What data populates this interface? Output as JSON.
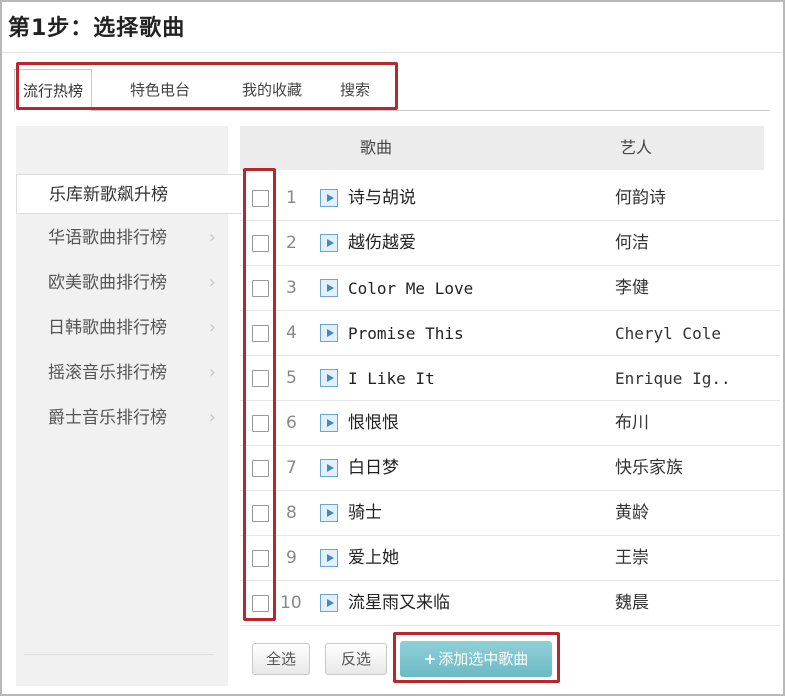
{
  "step_title": "第1步：选择歌曲",
  "tabs": [
    {
      "label": "流行热榜",
      "active": true
    },
    {
      "label": "特色电台",
      "active": false
    },
    {
      "label": "我的收藏",
      "active": false
    },
    {
      "label": "搜索",
      "active": false
    }
  ],
  "sidebar": {
    "items": [
      {
        "label": "乐库新歌飙升榜",
        "active": true,
        "icon": "chevron-right-icon"
      },
      {
        "label": "华语歌曲排行榜",
        "active": false,
        "icon": "chevron-right-icon"
      },
      {
        "label": "欧美歌曲排行榜",
        "active": false,
        "icon": "chevron-right-icon"
      },
      {
        "label": "日韩歌曲排行榜",
        "active": false,
        "icon": "chevron-right-icon"
      },
      {
        "label": "摇滚音乐排行榜",
        "active": false,
        "icon": "chevron-right-icon"
      },
      {
        "label": "爵士音乐排行榜",
        "active": false,
        "icon": "chevron-right-icon"
      }
    ]
  },
  "table": {
    "headers": {
      "song": "歌曲",
      "artist": "艺人"
    },
    "rows": [
      {
        "num": "1",
        "song": "诗与胡说",
        "artist": "何韵诗",
        "checked": false
      },
      {
        "num": "2",
        "song": "越伤越爱",
        "artist": "何洁",
        "checked": false
      },
      {
        "num": "3",
        "song": "Color Me Love",
        "artist": "李健",
        "checked": false
      },
      {
        "num": "4",
        "song": "Promise This",
        "artist": "Cheryl Cole",
        "checked": false
      },
      {
        "num": "5",
        "song": "I Like It",
        "artist": "Enrique Ig..",
        "checked": false
      },
      {
        "num": "6",
        "song": "恨恨恨",
        "artist": "布川",
        "checked": false
      },
      {
        "num": "7",
        "song": "白日梦",
        "artist": "快乐家族",
        "checked": false
      },
      {
        "num": "8",
        "song": "骑士",
        "artist": "黄龄",
        "checked": false
      },
      {
        "num": "9",
        "song": "爱上她",
        "artist": "王崇",
        "checked": false
      },
      {
        "num": "10",
        "song": "流星雨又来临",
        "artist": "魏晨",
        "checked": false
      }
    ]
  },
  "buttons": {
    "select_all": "全选",
    "invert_select": "反选",
    "add_plus": "+",
    "add_selected": "添加选中歌曲"
  },
  "colors": {
    "highlight": "#b8262e",
    "add_button": "#7cc4cd",
    "play_icon": "#3f8bc4"
  }
}
